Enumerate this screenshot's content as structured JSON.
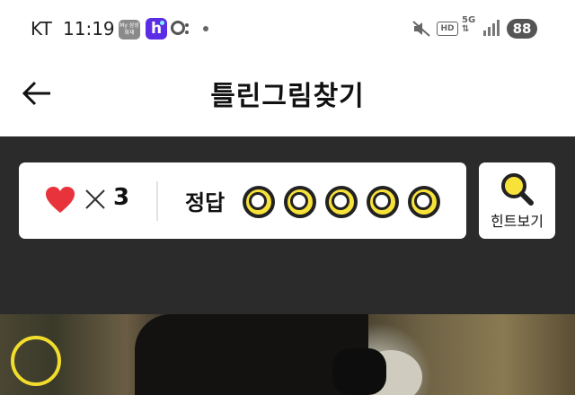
{
  "status_bar": {
    "carrier": "KT",
    "time": "11:19",
    "app_icon_label": "My 삼성화재",
    "app_icon_letter": "h",
    "hd_label": "HD",
    "network_label": "5G",
    "battery": "88"
  },
  "header": {
    "title": "틀린그림찾기"
  },
  "game": {
    "lives_count": "3",
    "answer_label": "정답",
    "answers_total": 5,
    "answers_found": 0,
    "hint_label": "힌트보기"
  },
  "colors": {
    "dark_panel": "#2b2b2b",
    "heart": "#e8323c",
    "answer_circle": "#f7e23a",
    "hint_icon": "#f7e23a",
    "marker": "#f2dd2c"
  }
}
